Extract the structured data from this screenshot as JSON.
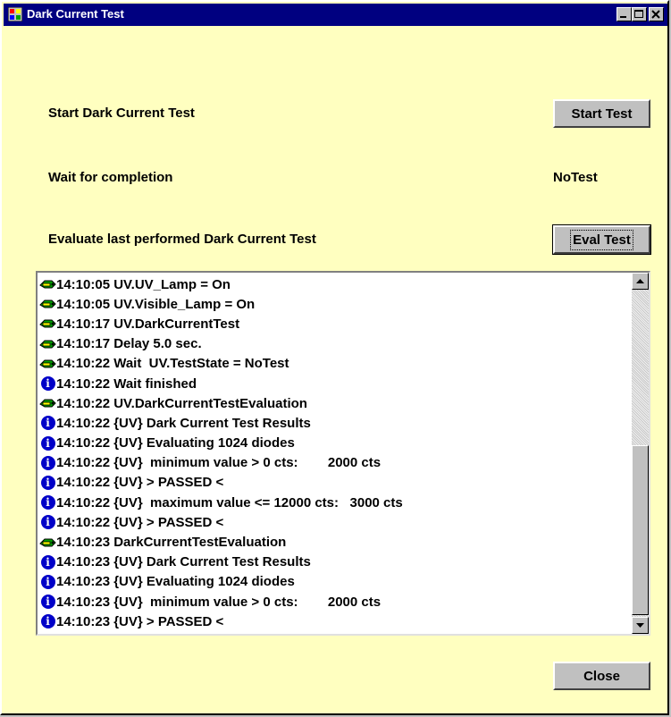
{
  "window": {
    "title": "Dark Current Test",
    "icons": {
      "app": "app-window-icon",
      "minimize": "minimize-icon",
      "maximize": "maximize-icon",
      "close": "close-x-icon"
    }
  },
  "rows": {
    "start_label": "Start Dark Current Test",
    "start_button": "Start Test",
    "wait_label": "Wait for completion",
    "wait_status": "NoTest",
    "eval_label": "Evaluate last performed Dark Current Test",
    "eval_button": "Eval Test"
  },
  "log": {
    "lines": [
      {
        "icon": "command-icon",
        "text": "14:10:05 UV.UV_Lamp = On"
      },
      {
        "icon": "command-icon",
        "text": "14:10:05 UV.Visible_Lamp = On"
      },
      {
        "icon": "command-icon",
        "text": "14:10:17 UV.DarkCurrentTest"
      },
      {
        "icon": "command-icon",
        "text": "14:10:17 Delay 5.0 sec."
      },
      {
        "icon": "command-icon",
        "text": "14:10:22 Wait  UV.TestState = NoTest"
      },
      {
        "icon": "info-icon",
        "text": "14:10:22 Wait finished"
      },
      {
        "icon": "command-icon",
        "text": "14:10:22 UV.DarkCurrentTestEvaluation"
      },
      {
        "icon": "info-icon",
        "text": "14:10:22 {UV} Dark Current Test Results"
      },
      {
        "icon": "info-icon",
        "text": "14:10:22 {UV} Evaluating 1024 diodes"
      },
      {
        "icon": "info-icon",
        "text": "14:10:22 {UV}  minimum value > 0 cts:        2000 cts"
      },
      {
        "icon": "info-icon",
        "text": "14:10:22 {UV} > PASSED <"
      },
      {
        "icon": "info-icon",
        "text": "14:10:22 {UV}  maximum value <= 12000 cts:   3000 cts"
      },
      {
        "icon": "info-icon",
        "text": "14:10:22 {UV} > PASSED <"
      },
      {
        "icon": "command-icon",
        "text": "14:10:23 DarkCurrentTestEvaluation"
      },
      {
        "icon": "info-icon",
        "text": "14:10:23 {UV} Dark Current Test Results"
      },
      {
        "icon": "info-icon",
        "text": "14:10:23 {UV} Evaluating 1024 diodes"
      },
      {
        "icon": "info-icon",
        "text": "14:10:23 {UV}  minimum value > 0 cts:        2000 cts"
      },
      {
        "icon": "info-icon",
        "text": "14:10:23 {UV} > PASSED <"
      }
    ],
    "scrollbar": {
      "up": "scroll-up-arrow-icon",
      "down": "scroll-down-arrow-icon"
    }
  },
  "footer": {
    "close_button": "Close"
  },
  "colors": {
    "background": "#ffffc0",
    "titlebar": "#000080",
    "button": "#c0c0c0",
    "info_icon": "#0000c8",
    "command_icon": "#008000"
  }
}
